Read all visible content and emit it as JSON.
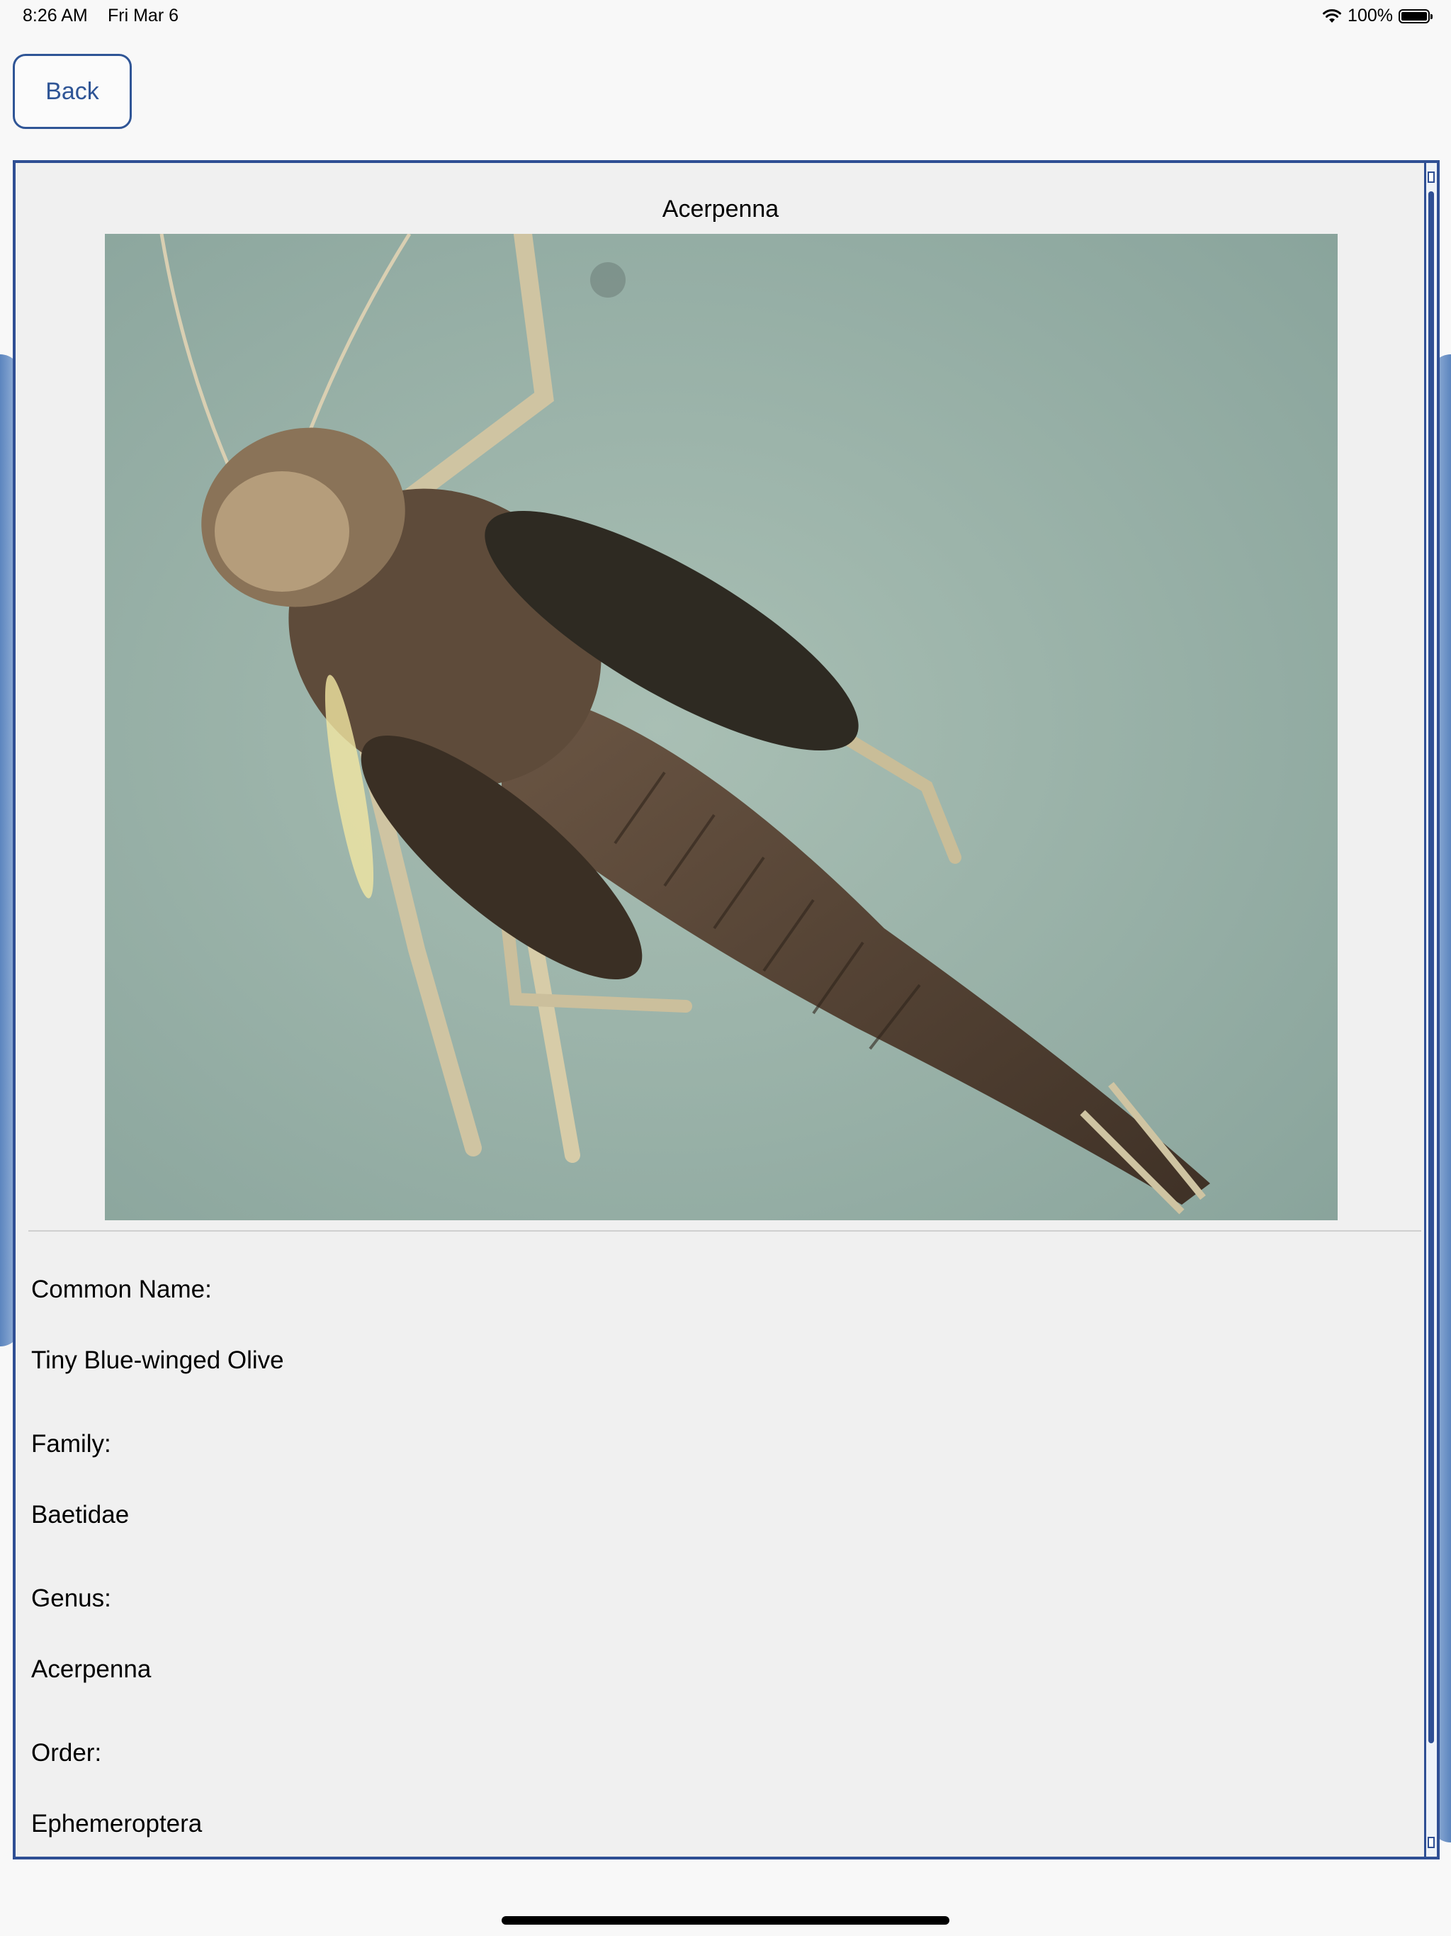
{
  "status_bar": {
    "time": "8:26 AM",
    "date": "Fri Mar 6",
    "battery": "100%"
  },
  "nav": {
    "back_label": "Back"
  },
  "species": {
    "title": "Acerpenna",
    "image_alt": "Acerpenna mayfly nymph specimen photo"
  },
  "fields": [
    {
      "label": "Common Name:",
      "value": "Tiny Blue-winged Olive"
    },
    {
      "label": "Family:",
      "value": "Baetidae"
    },
    {
      "label": "Genus:",
      "value": "Acerpenna"
    },
    {
      "label": "Order:",
      "value": "Ephemeroptera"
    }
  ],
  "colors": {
    "accent": "#2f5596",
    "panel_border": "#2f4f94"
  }
}
